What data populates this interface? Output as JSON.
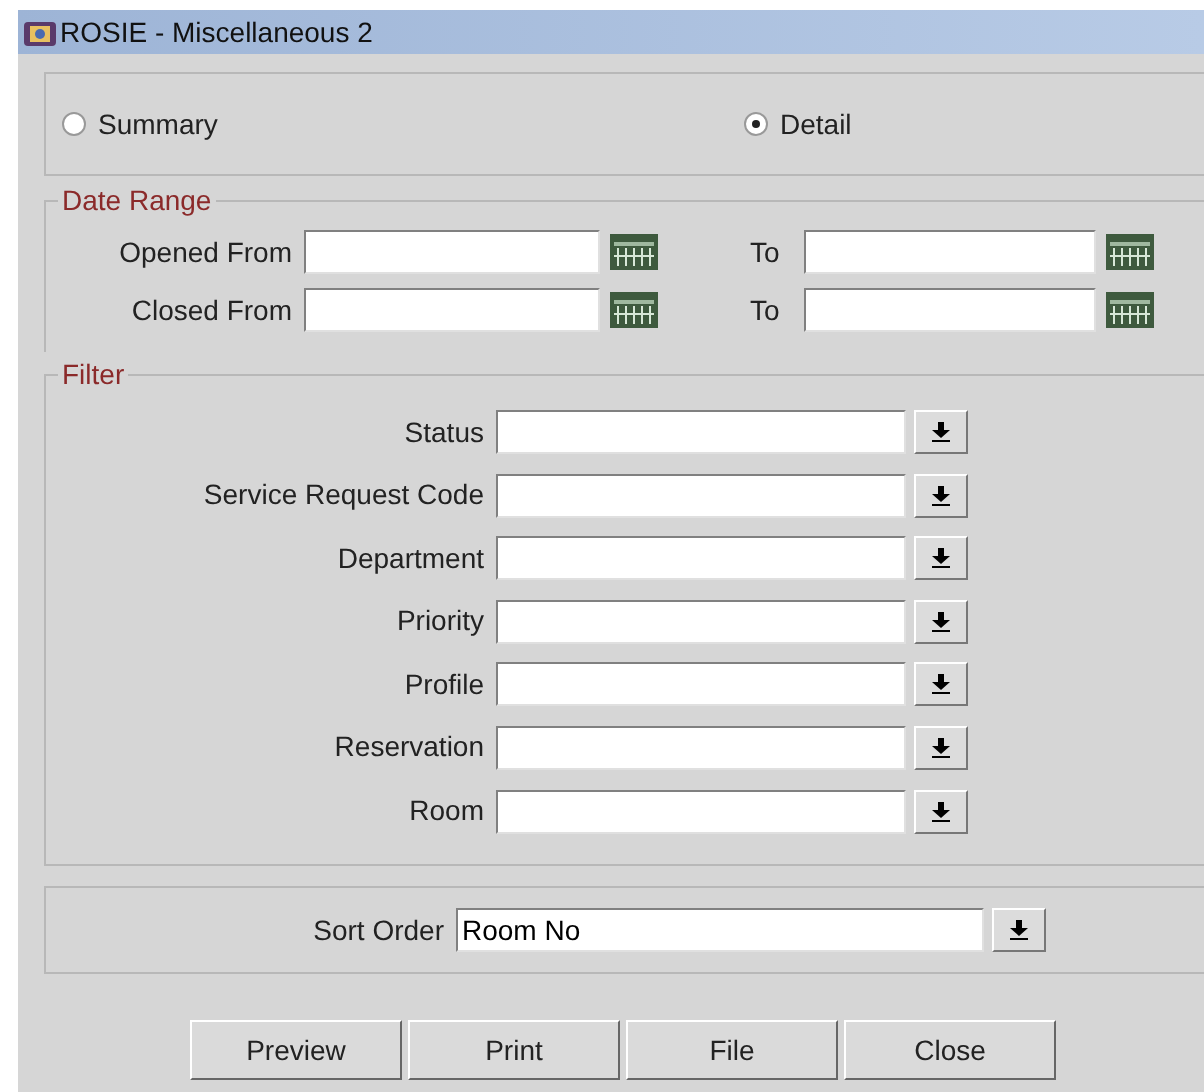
{
  "window": {
    "title": "ROSIE - Miscellaneous 2"
  },
  "report_type": [
    {
      "label": "Summary",
      "selected": false
    },
    {
      "label": "Detail",
      "selected": true
    }
  ],
  "date_range": {
    "title": "Date Range",
    "rows": [
      {
        "label": "Opened From",
        "to_label": "To"
      },
      {
        "label": "Closed From",
        "to_label": "To"
      }
    ]
  },
  "filter": {
    "title": "Filter",
    "fields": [
      {
        "label": "Status"
      },
      {
        "label": "Service Request Code"
      },
      {
        "label": "Department"
      },
      {
        "label": "Priority"
      },
      {
        "label": "Profile"
      },
      {
        "label": "Reservation"
      },
      {
        "label": "Room"
      }
    ]
  },
  "sort_order": {
    "label": "Sort Order",
    "value": "Room No"
  },
  "buttons": [
    {
      "label": "Preview"
    },
    {
      "label": "Print"
    },
    {
      "label": "File"
    },
    {
      "label": "Close"
    }
  ]
}
